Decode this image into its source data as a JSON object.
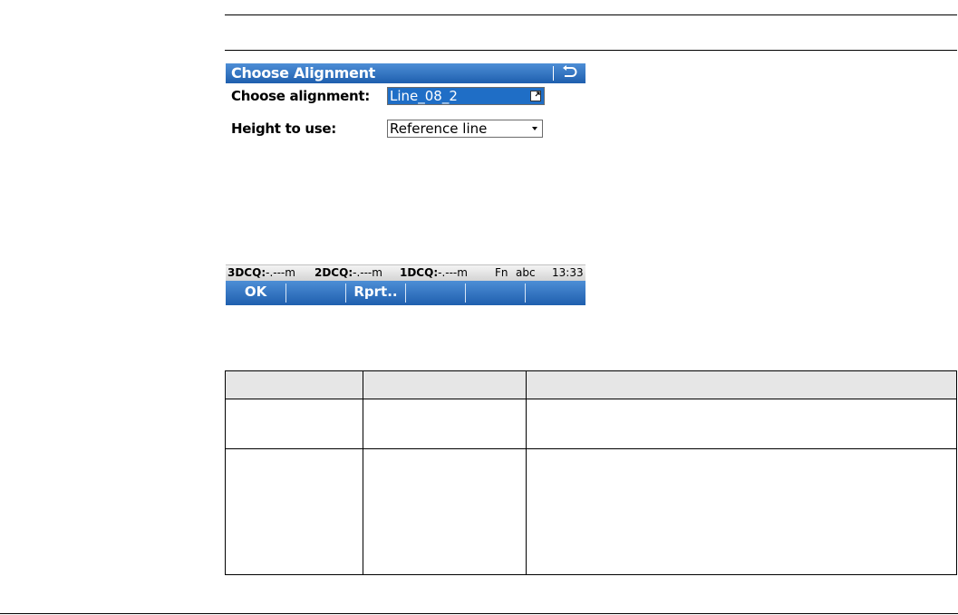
{
  "screen": {
    "title": "Choose Alignment",
    "fields": [
      {
        "label": "Choose alignment:",
        "value": "Line_08_2"
      },
      {
        "label": "Height to use:",
        "value": "Reference line"
      }
    ],
    "status": {
      "q3_label": "3DCQ:",
      "q3_value": "-.---m",
      "q2_label": "2DCQ:",
      "q2_value": "-.---m",
      "q1_label": "1DCQ:",
      "q1_value": "-.---m",
      "fn": "Fn",
      "mode": "abc",
      "time": "13:33"
    },
    "softkeys": [
      "OK",
      "",
      "Rprt..",
      "",
      "",
      ""
    ]
  },
  "colors": {
    "title_bar": "#2b6cc0",
    "selection": "#1f6ec6",
    "status_bar": "#e0e0e0",
    "softkey_bar": "#2b6cc0"
  },
  "icons": {
    "titlebar": "back-arrow-icon",
    "choose_alignment": "list-select-icon",
    "height_to_use": "dropdown-arrow-icon"
  },
  "table": {
    "headers": [
      "",
      "",
      ""
    ],
    "rows": [
      [
        "",
        "",
        ""
      ],
      [
        "",
        "",
        ""
      ]
    ]
  }
}
